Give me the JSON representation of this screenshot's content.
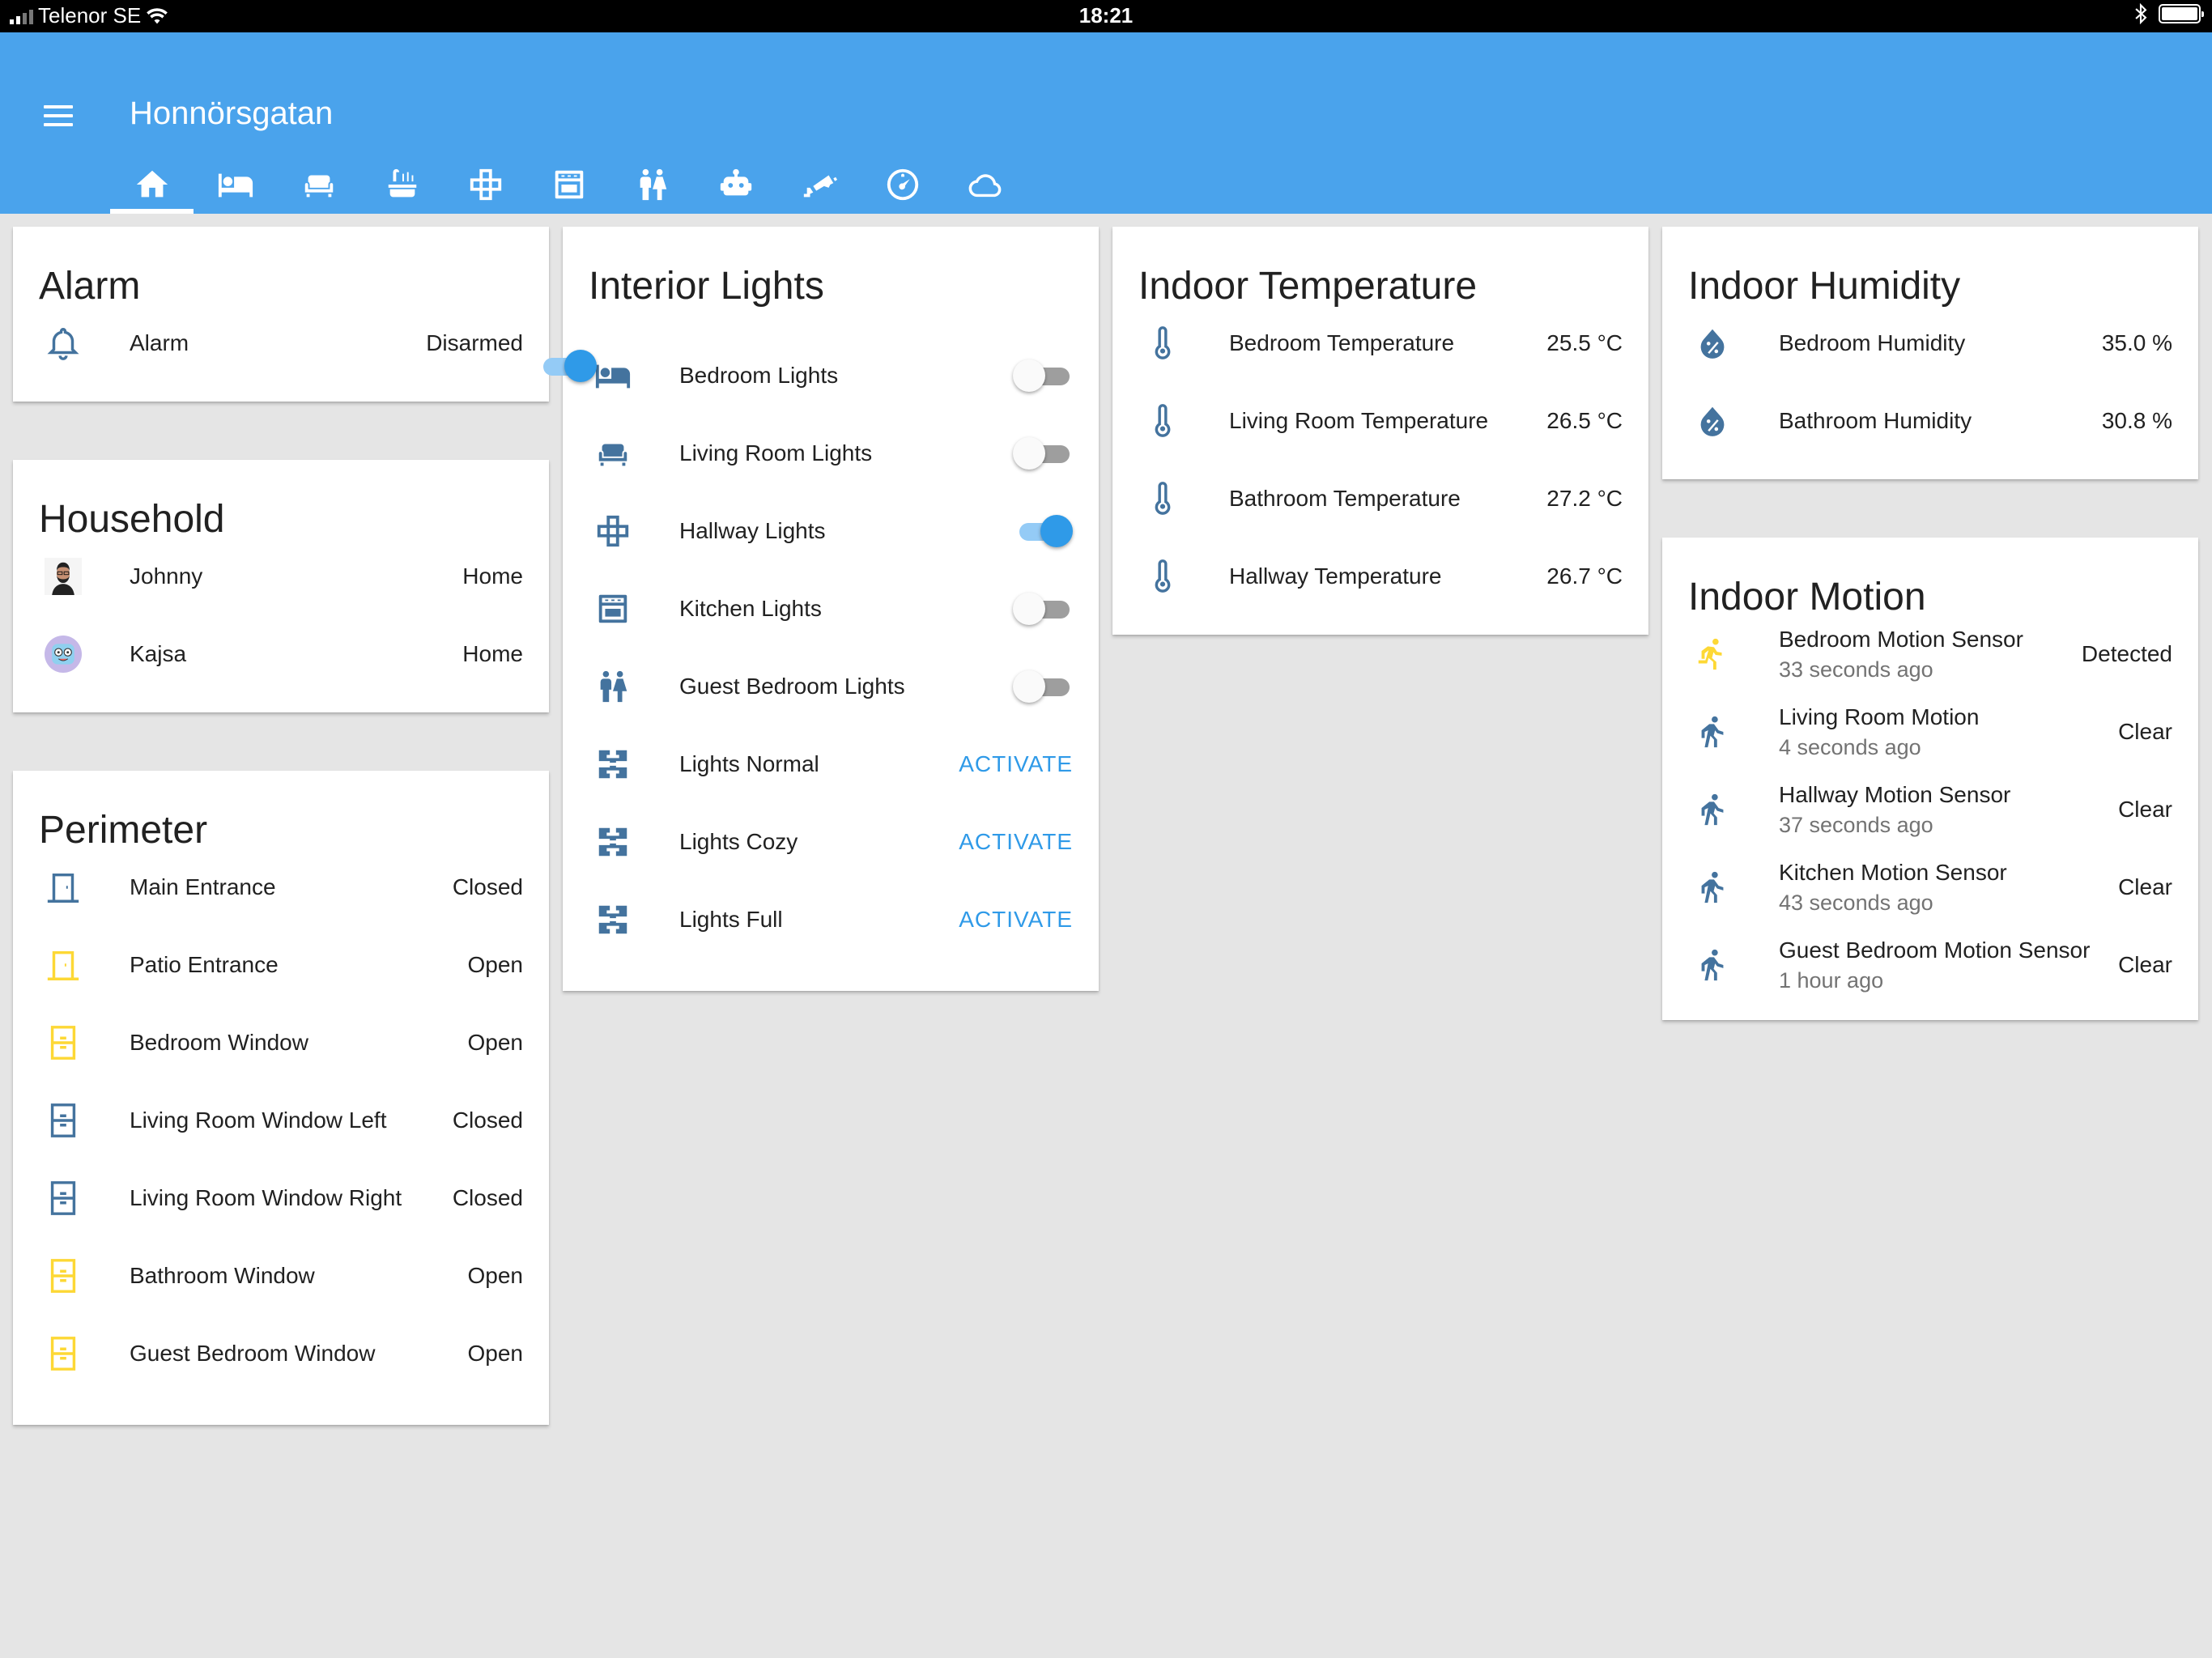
{
  "status_bar": {
    "carrier": "Telenor SE",
    "time": "18:21"
  },
  "app": {
    "title": "Honnörsgatan"
  },
  "tabs": [
    {
      "icon": "home-icon",
      "active": true
    },
    {
      "icon": "bed-icon"
    },
    {
      "icon": "sofa-icon"
    },
    {
      "icon": "bathtub-icon"
    },
    {
      "icon": "hallway-icon"
    },
    {
      "icon": "stove-icon"
    },
    {
      "icon": "human-male-female-icon"
    },
    {
      "icon": "robot-icon"
    },
    {
      "icon": "cctv-icon"
    },
    {
      "icon": "gauge-icon"
    },
    {
      "icon": "cloud-icon"
    }
  ],
  "colors": {
    "primary": "#4aa3ec",
    "accent": "#2f9ae8",
    "icon_default": "#44739e",
    "icon_active": "#fdd835"
  },
  "alarm": {
    "title": "Alarm",
    "rows": [
      {
        "name": "Alarm",
        "state": "Disarmed"
      }
    ]
  },
  "household": {
    "title": "Household",
    "rows": [
      {
        "name": "Johnny",
        "state": "Home"
      },
      {
        "name": "Kajsa",
        "state": "Home"
      }
    ]
  },
  "perimeter": {
    "title": "Perimeter",
    "rows": [
      {
        "name": "Main Entrance",
        "state": "Closed",
        "icon": "door-closed-icon"
      },
      {
        "name": "Patio Entrance",
        "state": "Open",
        "icon": "door-open-icon"
      },
      {
        "name": "Bedroom Window",
        "state": "Open",
        "icon": "window-open-icon"
      },
      {
        "name": "Living Room Window Left",
        "state": "Closed",
        "icon": "window-closed-icon"
      },
      {
        "name": "Living Room Window Right",
        "state": "Closed",
        "icon": "window-closed-icon"
      },
      {
        "name": "Bathroom Window",
        "state": "Open",
        "icon": "window-open-icon"
      },
      {
        "name": "Guest Bedroom Window",
        "state": "Open",
        "icon": "window-open-icon"
      }
    ]
  },
  "interior_lights": {
    "title": "Interior Lights",
    "master_on": true,
    "lights": [
      {
        "name": "Bedroom Lights",
        "on": false,
        "icon": "bed-icon"
      },
      {
        "name": "Living Room Lights",
        "on": false,
        "icon": "sofa-icon"
      },
      {
        "name": "Hallway Lights",
        "on": true,
        "icon": "hallway-icon"
      },
      {
        "name": "Kitchen Lights",
        "on": false,
        "icon": "stove-icon"
      },
      {
        "name": "Guest Bedroom Lights",
        "on": false,
        "icon": "human-male-female-icon"
      }
    ],
    "scenes": [
      {
        "name": "Lights Normal",
        "action": "ACTIVATE",
        "icon": "scene-icon"
      },
      {
        "name": "Lights Cozy",
        "action": "ACTIVATE",
        "icon": "scene-icon"
      },
      {
        "name": "Lights Full",
        "action": "ACTIVATE",
        "icon": "scene-icon"
      }
    ]
  },
  "indoor_temperature": {
    "title": "Indoor Temperature",
    "rows": [
      {
        "name": "Bedroom Temperature",
        "value": "25.5 °C"
      },
      {
        "name": "Living Room Temperature",
        "value": "26.5 °C"
      },
      {
        "name": "Bathroom Temperature",
        "value": "27.2 °C"
      },
      {
        "name": "Hallway Temperature",
        "value": "26.7 °C"
      }
    ]
  },
  "indoor_humidity": {
    "title": "Indoor Humidity",
    "rows": [
      {
        "name": "Bedroom Humidity",
        "value": "35.0 %"
      },
      {
        "name": "Bathroom Humidity",
        "value": "30.8 %"
      }
    ]
  },
  "indoor_motion": {
    "title": "Indoor Motion",
    "rows": [
      {
        "name": "Bedroom Motion Sensor",
        "time": "33 seconds ago",
        "state": "Detected",
        "active": true
      },
      {
        "name": "Living Room Motion",
        "time": "4 seconds ago",
        "state": "Clear"
      },
      {
        "name": "Hallway Motion Sensor",
        "time": "37 seconds ago",
        "state": "Clear"
      },
      {
        "name": "Kitchen Motion Sensor",
        "time": "43 seconds ago",
        "state": "Clear"
      },
      {
        "name": "Guest Bedroom Motion Sensor",
        "time": "1 hour ago",
        "state": "Clear"
      }
    ]
  }
}
